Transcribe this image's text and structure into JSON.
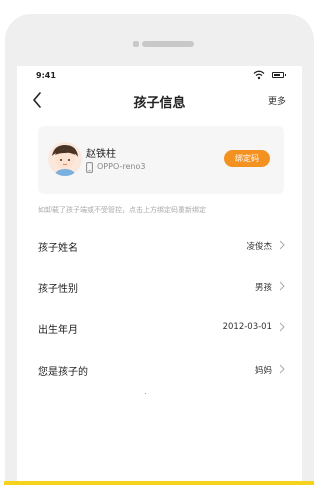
{
  "status_bar": {
    "time": "9:41"
  },
  "nav": {
    "title": "孩子信息",
    "more_label": "更多"
  },
  "profile": {
    "name": "赵铁柱",
    "device": "OPPO-reno3",
    "bind_button_label": "绑定码"
  },
  "hint": "如卸载了孩子端或不受管控，点击上方绑定码重新绑定",
  "rows": [
    {
      "label": "孩子姓名",
      "value": "凌俊杰"
    },
    {
      "label": "孩子性别",
      "value": "男孩"
    },
    {
      "label": "出生年月",
      "value": "2012-03-01"
    },
    {
      "label": "您是孩子的",
      "value": "妈妈"
    }
  ],
  "colors": {
    "accent": "#f39121",
    "bottom_strip": "#f5d21b"
  }
}
